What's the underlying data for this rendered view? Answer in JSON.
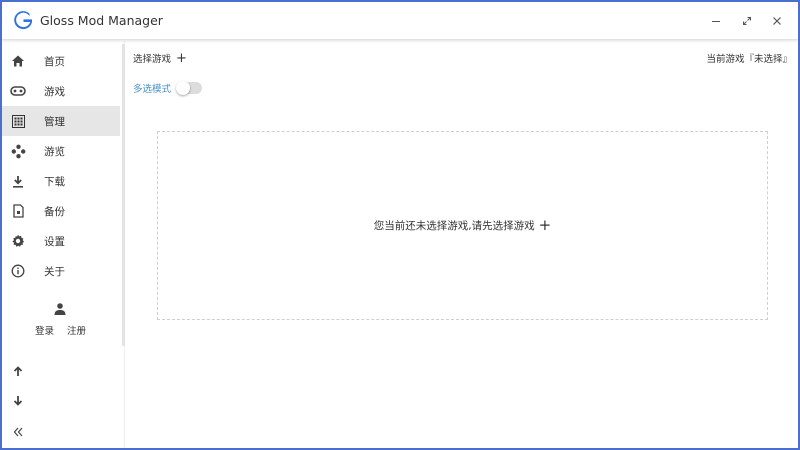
{
  "window": {
    "title": "Gloss Mod Manager",
    "logo_letter": "G",
    "controls": {
      "minimize": "—",
      "maximize": "⤢",
      "close": "✕"
    }
  },
  "sidebar": {
    "items": [
      {
        "label": "首页",
        "icon": "home-icon"
      },
      {
        "label": "游戏",
        "icon": "gamepad-icon"
      },
      {
        "label": "管理",
        "icon": "grid-icon",
        "active": true
      },
      {
        "label": "游览",
        "icon": "dots-icon"
      },
      {
        "label": "下载",
        "icon": "download-icon"
      },
      {
        "label": "备份",
        "icon": "backup-file-icon"
      },
      {
        "label": "设置",
        "icon": "gear-icon"
      },
      {
        "label": "关于",
        "icon": "info-icon"
      }
    ],
    "user": {
      "login": "登录",
      "register": "注册"
    },
    "bottom": [
      "arrow-up-icon",
      "arrow-down-icon",
      "collapse-icon"
    ]
  },
  "main": {
    "select_game": "选择游戏",
    "current_game": "当前游戏『未选择』",
    "multi_select_label": "多选模式",
    "multi_select_on": false,
    "empty_message": "您当前还未选择游戏,请先选择游戏"
  },
  "colors": {
    "accent": "#4a90c8",
    "active_bg": "#e6e6e6",
    "logo_blue": "#2f73e0",
    "frame": "#4a6fd1"
  }
}
